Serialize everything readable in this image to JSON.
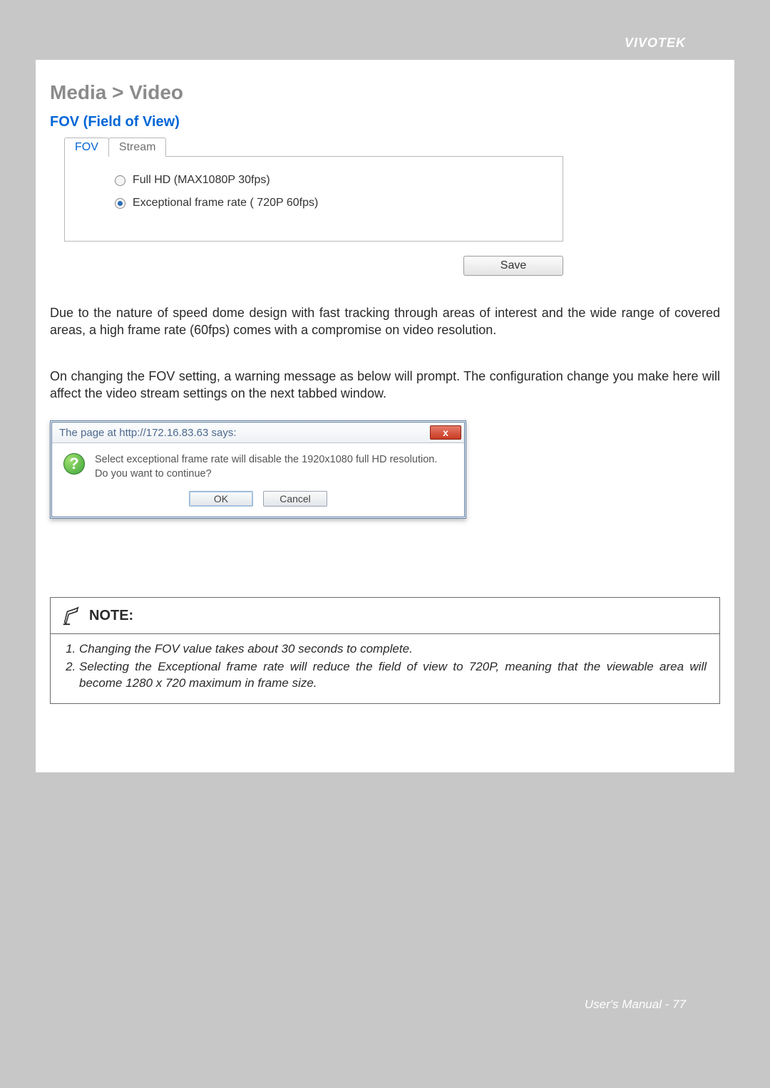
{
  "brand": "VIVOTEK",
  "breadcrumb": "Media > Video",
  "section_heading": "FOV (Field of View)",
  "tabs": {
    "fov": "FOV",
    "stream": "Stream"
  },
  "fov_panel": {
    "option1": "Full HD (MAX1080P 30fps)",
    "option2": "Exceptional frame rate ( 720P 60fps)",
    "selected": "option2",
    "save_label": "Save"
  },
  "paragraph1": "Due to the nature of speed dome design with fast tracking through areas of interest and the wide range of covered areas, a high frame rate (60fps) comes with a compromise on video resolution.",
  "paragraph2": "On changing the FOV setting, a warning message as below will prompt. The configuration change you make here will affect the video stream settings on the next tabbed window.",
  "dialog": {
    "title": "The page at http://172.16.83.63 says:",
    "close_glyph": "x",
    "question_glyph": "?",
    "message": "Select exceptional frame rate will disable the 1920x1080 full HD resolution. Do you want to continue?",
    "ok_label": "OK",
    "cancel_label": "Cancel"
  },
  "note": {
    "title": "NOTE:",
    "items": [
      "Changing the FOV value takes about 30 seconds to complete.",
      "Selecting the Exceptional frame rate will reduce the field of view to 720P, meaning that the viewable area will become 1280 x 720 maximum in frame size."
    ]
  },
  "footer": "User's Manual - 77"
}
